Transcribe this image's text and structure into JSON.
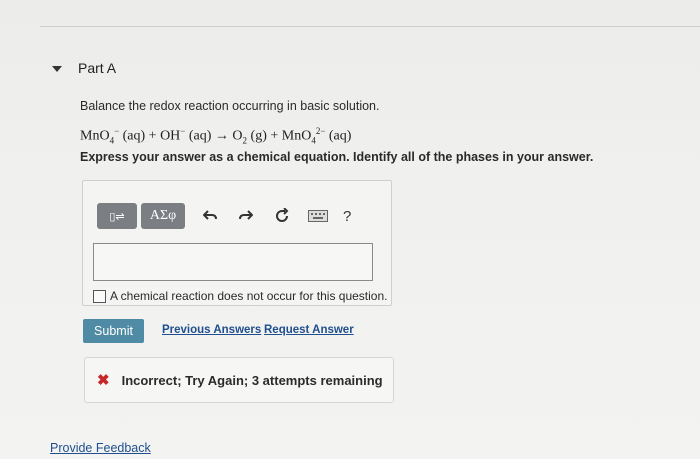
{
  "part": {
    "title": "Part A"
  },
  "question": {
    "prompt": "Balance the redox reaction occurring in basic solution.",
    "equation_parts": {
      "a": "MnO",
      "a_sub": "4",
      "a_sup": "−",
      "a_phase": "(aq) + OH",
      "b_sup": "−",
      "b_phase": "(aq) → O",
      "c_sub": "2",
      "c_phase": "(g) + MnO",
      "d_sub": "4",
      "d_sup": "2−",
      "d_phase": "(aq)"
    },
    "instruction": "Express your answer as a chemical equation. Identify all of the phases in your answer."
  },
  "toolbar": {
    "templates_label": "▯⇌",
    "greek_label": "ΑΣφ",
    "undo_icon": "undo-icon",
    "redo_icon": "redo-icon",
    "reset_icon": "reset-icon",
    "keyboard_icon": "keyboard-icon",
    "help_label": "?"
  },
  "answer": {
    "value": "",
    "no_reaction_label": "A chemical reaction does not occur for this question."
  },
  "actions": {
    "submit_label": "Submit",
    "previous_answers_label": "Previous Answers",
    "request_answer_label": "Request Answer"
  },
  "feedback": {
    "status": "Incorrect; Try Again; 3 attempts remaining",
    "status_color": "#c62828"
  },
  "footer": {
    "provide_feedback_label": "Provide Feedback"
  }
}
